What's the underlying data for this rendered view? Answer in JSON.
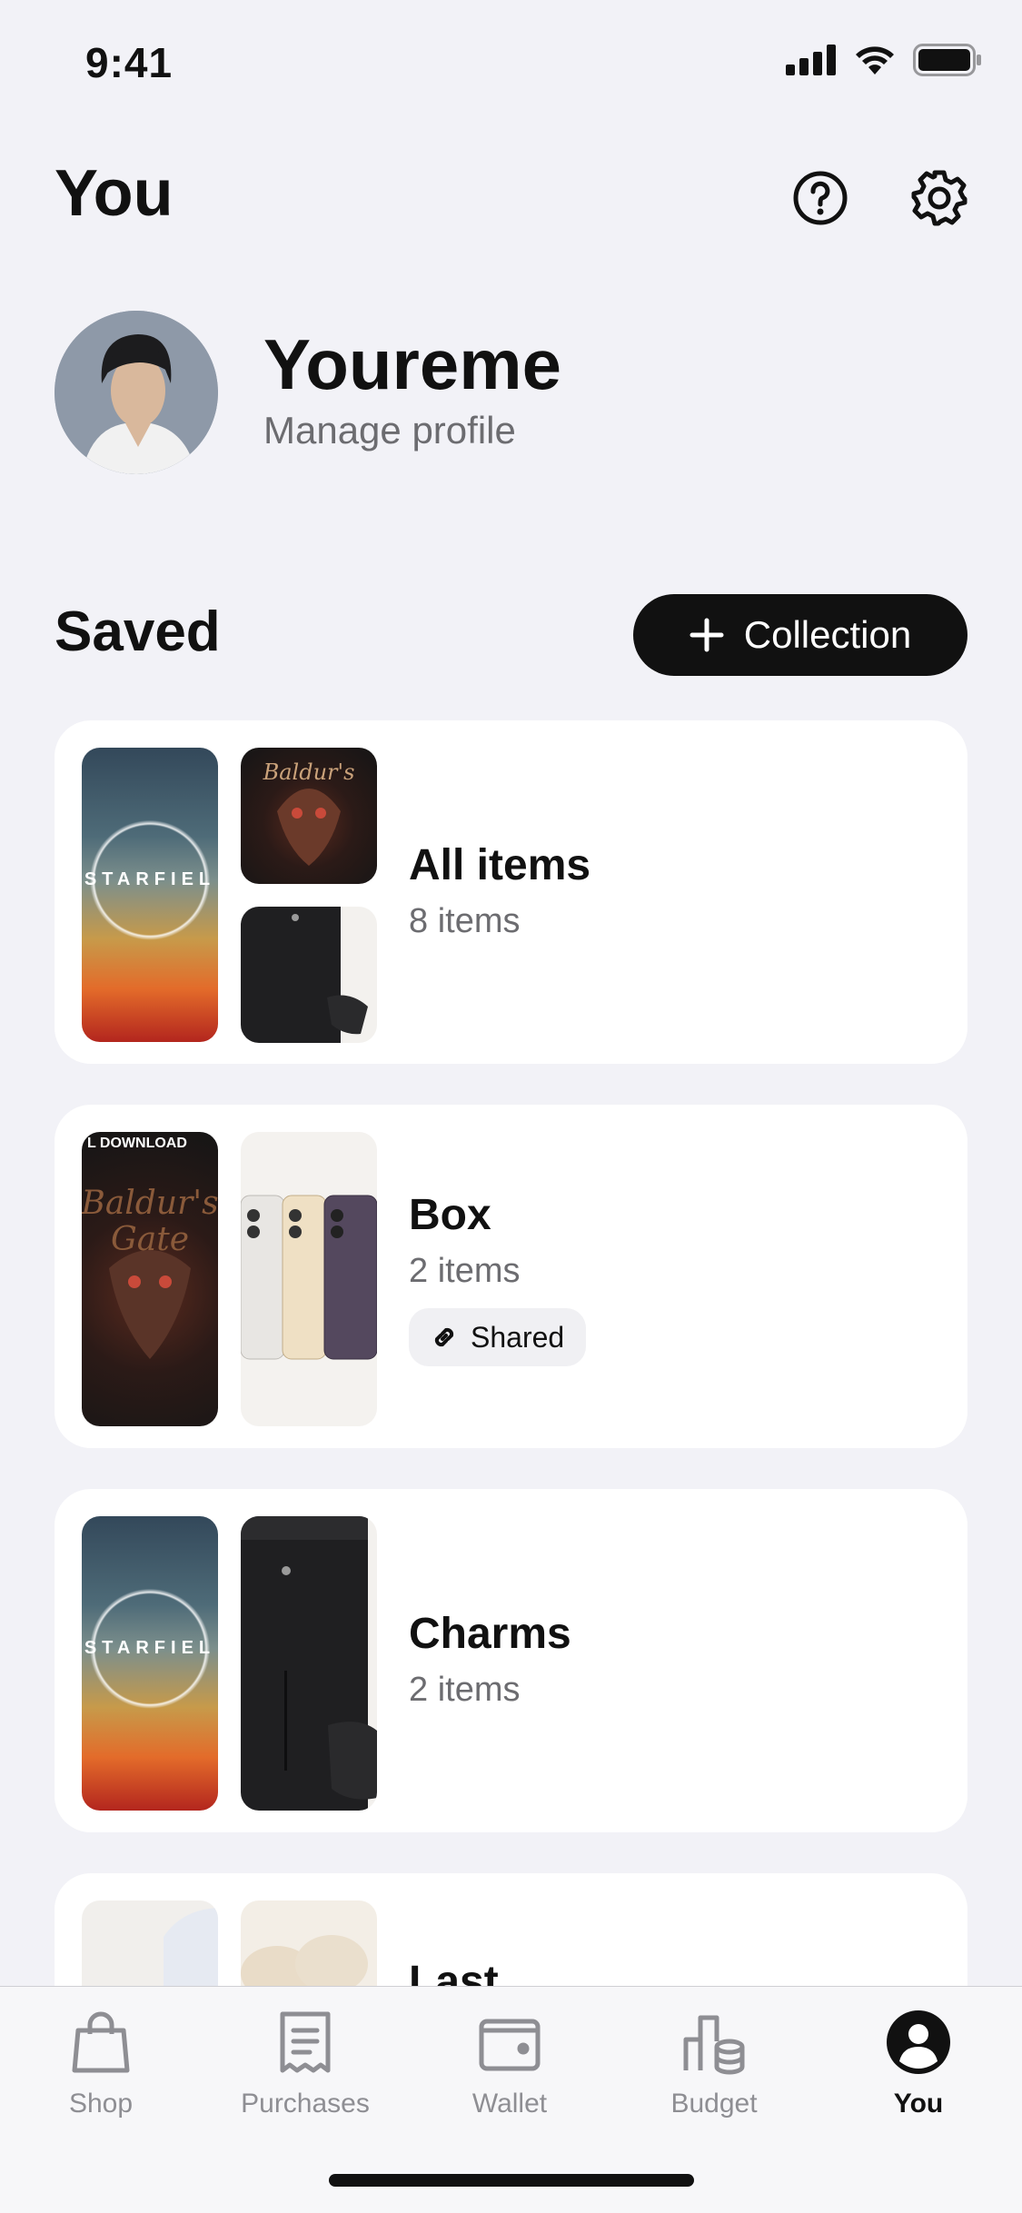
{
  "status_bar": {
    "time": "9:41"
  },
  "header": {
    "title": "You",
    "help_icon": "question-circle-icon",
    "settings_icon": "gear-icon"
  },
  "profile": {
    "name": "Youreme",
    "subtitle": "Manage profile"
  },
  "saved": {
    "title": "Saved",
    "add_button_label": "Collection",
    "collections": [
      {
        "title": "All items",
        "count": "8 items"
      },
      {
        "title": "Box",
        "count": "2 items",
        "badge": "Shared"
      },
      {
        "title": "Charms",
        "count": "2 items"
      },
      {
        "title": "Last"
      }
    ],
    "thumb_texts": {
      "starfield": "STARFIEL",
      "download": "L DOWNLOAD"
    }
  },
  "tabbar": {
    "tabs": [
      {
        "label": "Shop",
        "icon": "shopping-bag-icon"
      },
      {
        "label": "Purchases",
        "icon": "receipt-icon"
      },
      {
        "label": "Wallet",
        "icon": "wallet-icon"
      },
      {
        "label": "Budget",
        "icon": "budget-icon"
      },
      {
        "label": "You",
        "icon": "profile-icon",
        "active": true
      }
    ]
  }
}
